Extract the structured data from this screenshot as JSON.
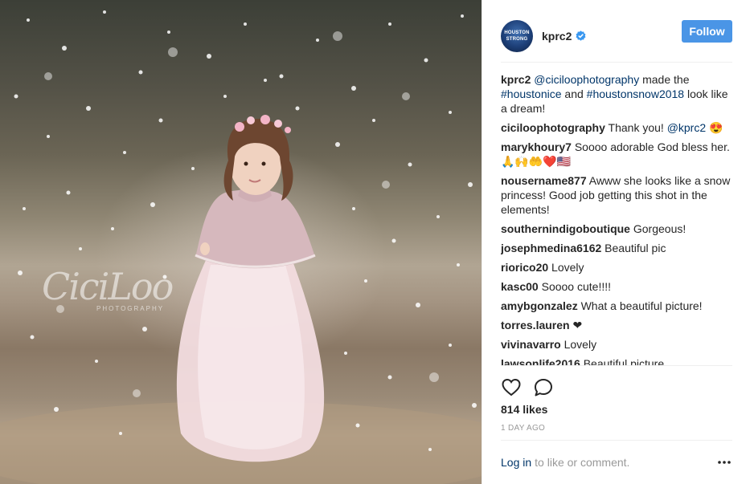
{
  "post": {
    "watermark_text": "CiciLoo",
    "watermark_subtext": "PHOTOGRAPHY"
  },
  "header": {
    "avatar_line1": "HOUSTON",
    "avatar_line2": "STRONG",
    "username": "kprc2",
    "verified_icon": "verified-badge-icon",
    "follow_label": "Follow",
    "accent_color": "#4a95e6"
  },
  "caption": {
    "user": "kprc2",
    "mention": "@ciciloophotography",
    "text1": " made the ",
    "hashtag1": "#houstonice",
    "text2": " and ",
    "hashtag2": "#houstonsnow2018",
    "text3": " look like a dream!"
  },
  "comments": [
    {
      "user": "ciciloophotography",
      "text": "Thank you! ",
      "mention": "@kprc2",
      "suffix": " 😍"
    },
    {
      "user": "marykhoury7",
      "text": "Soooo adorable God bless her. 🙏🙌🤲❤️🇺🇸"
    },
    {
      "user": "nousername877",
      "text": "Awww she looks like a snow princess! Good job getting this shot in the elements!"
    },
    {
      "user": "southernindigoboutique",
      "text": "Gorgeous!"
    },
    {
      "user": "josephmedina6162",
      "text": "Beautiful pic"
    },
    {
      "user": "riorico20",
      "text": "Lovely"
    },
    {
      "user": "kasc00",
      "text": "Soooo cute!!!!"
    },
    {
      "user": "amybgonzalez",
      "text": "What a beautiful picture!"
    },
    {
      "user": "torres.lauren",
      "text": "❤"
    },
    {
      "user": "vivinavarro",
      "text": "Lovely"
    },
    {
      "user": "lawsonlife2016",
      "text": "Beautiful picture"
    }
  ],
  "actions": {
    "like_icon": "heart-icon",
    "comment_icon": "comment-icon",
    "likes": "814 likes",
    "time_ago": "1 DAY AGO"
  },
  "footer": {
    "login_link": "Log in",
    "login_rest": "to like or comment.",
    "more_icon": "more-options-icon"
  }
}
